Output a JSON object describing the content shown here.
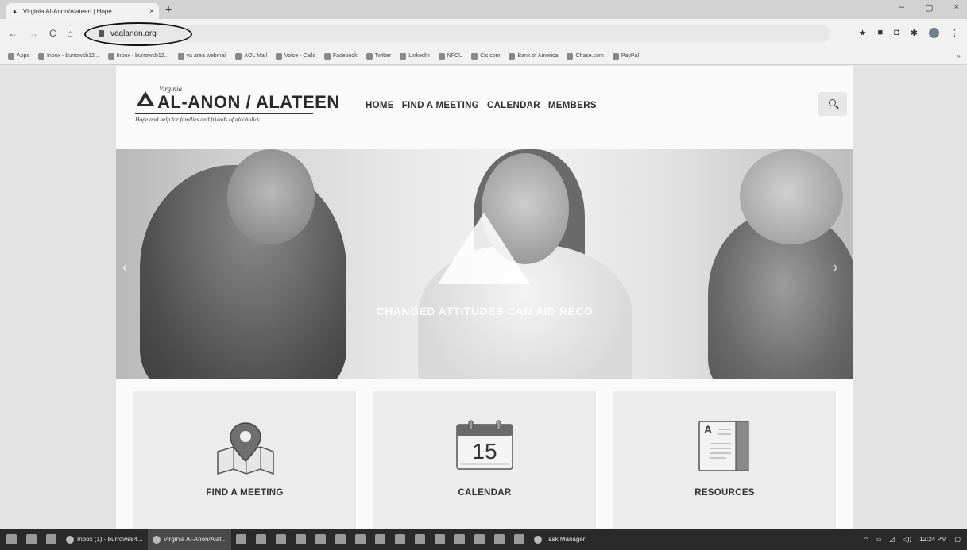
{
  "browser": {
    "tab_title": "Virginia Al-Anon/Alateen | Hope",
    "tab_close": "×",
    "new_tab": "+",
    "window_controls": [
      "–",
      "▢",
      "×"
    ],
    "nav": {
      "back": "←",
      "forward": "→",
      "reload": "C",
      "home": "⌂"
    },
    "url": "vaalanon.org",
    "bookmarks": [
      {
        "label": "Apps",
        "icon": "apps-grid-icon"
      },
      {
        "label": "Inbox - burrowsb12...",
        "icon": "gmail-icon"
      },
      {
        "label": "Inbox - burrowsb12...",
        "icon": "gmail-icon"
      },
      {
        "label": "va area webmail",
        "icon": "webmail-icon"
      },
      {
        "label": "AOL Mail",
        "icon": "aol-icon"
      },
      {
        "label": "Voice - Calls",
        "icon": "voice-icon"
      },
      {
        "label": "Facebook",
        "icon": "facebook-icon"
      },
      {
        "label": "Twitter",
        "icon": "twitter-icon"
      },
      {
        "label": "LinkedIn",
        "icon": "linkedin-icon"
      },
      {
        "label": "NFCU",
        "icon": "nfcu-icon"
      },
      {
        "label": "Cis.com",
        "icon": "cis-icon"
      },
      {
        "label": "Bank of America",
        "icon": "bofa-icon"
      },
      {
        "label": "Chase.com",
        "icon": "chase-icon"
      },
      {
        "label": "PayPal",
        "icon": "paypal-icon"
      }
    ],
    "bookmarks_more": "»"
  },
  "site": {
    "logo": {
      "state": "Virginia",
      "name": "AL-ANON / ALATEEN",
      "tagline": "Hope and help for families and friends of alcoholics"
    },
    "nav": [
      "HOME",
      "FIND A MEETING",
      "CALENDAR",
      "MEMBERS"
    ],
    "hero": {
      "caption": "CHANGED ATTITUDES CAN AID RECO",
      "prev": "‹",
      "next": "›"
    },
    "tiles": [
      {
        "label": "FIND A MEETING",
        "icon": "map-pin-icon"
      },
      {
        "label": "CALENDAR",
        "icon": "calendar-icon",
        "day": "15"
      },
      {
        "label": "RESOURCES",
        "icon": "book-icon",
        "letter": "A"
      }
    ]
  },
  "taskbar": {
    "tasks": [
      {
        "label": "Inbox (1) - burrows84..."
      },
      {
        "label": "Virginia Al-Anon/Alat..."
      },
      {
        "label": "Task Manager"
      }
    ],
    "tray_arrow": "^",
    "volume": "◁))",
    "time": "12:24 PM"
  }
}
